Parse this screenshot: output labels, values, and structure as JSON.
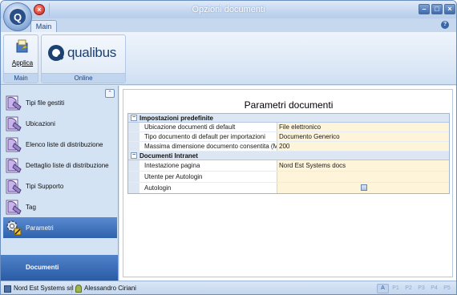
{
  "window": {
    "title": "Opzioni documenti"
  },
  "ribbon": {
    "tabs": [
      {
        "label": "Main"
      }
    ],
    "groups": {
      "main": {
        "label": "Main",
        "applica_label": "Applica"
      },
      "online": {
        "label": "Online",
        "logo_text": "qualibus"
      }
    }
  },
  "nav": {
    "items": [
      {
        "label": "Tipi file gestiti",
        "icon": "document-tray-icon"
      },
      {
        "label": "Ubicazioni",
        "icon": "document-tray-icon"
      },
      {
        "label": "Elenco liste di distribuzione",
        "icon": "document-tray-icon"
      },
      {
        "label": "Dettaglio liste di distribuzione",
        "icon": "document-tray-icon"
      },
      {
        "label": "Tipi Supporto",
        "icon": "document-tray-icon"
      },
      {
        "label": "Tag",
        "icon": "document-tray-icon"
      },
      {
        "label": "Parametri",
        "icon": "gear-icon",
        "selected": true
      }
    ],
    "section_label": "Documenti"
  },
  "main": {
    "title": "Parametri documenti",
    "categories": [
      {
        "name": "Impostazioni predefinite",
        "rows": [
          {
            "label": "Ubicazione documenti di default",
            "value": "File elettronico"
          },
          {
            "label": "Tipo documento di default per importazioni",
            "value": "Documento Generico"
          },
          {
            "label": "Massima dimensione documento consentita (MB)",
            "value": "200"
          }
        ]
      },
      {
        "name": "Documenti Intranet",
        "rows": [
          {
            "label": "Intestazione pagina",
            "value": "Nord Est Systems docs"
          },
          {
            "label": "Utente per Autologin",
            "value": ""
          },
          {
            "label": "Autologin",
            "value": ""
          }
        ]
      }
    ]
  },
  "statusbar": {
    "company": "Nord Est Systems srl",
    "user": "Alessandro Ciriani",
    "keys": [
      "A",
      "P1",
      "P2",
      "P3",
      "P4",
      "P5"
    ]
  },
  "colors": {
    "accent": "#2f62ad",
    "value_bg": "#fdf4d9",
    "ribbon_text": "#15428b"
  }
}
